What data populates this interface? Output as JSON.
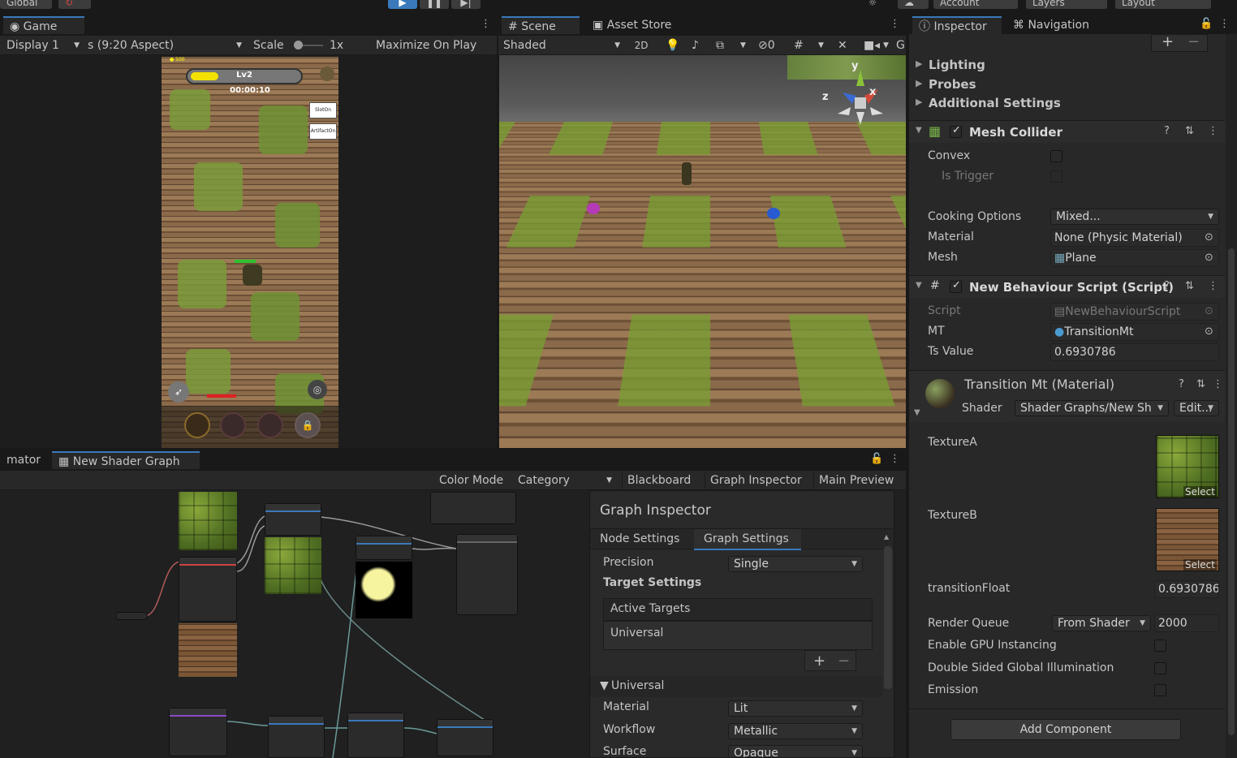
{
  "toolbar": {
    "global_label": "Global",
    "account_label": "Account",
    "layers_label": "Layers",
    "layout_label": "Layout"
  },
  "game": {
    "tab_label": "Game",
    "display": "Display 1",
    "aspect": "s (9:20 Aspect)",
    "scale_label": "Scale",
    "scale_value": "1x",
    "maximize": "Maximize On Play",
    "hud_level": "Lv2",
    "hud_timer": "00:00:10",
    "hud_coins": "500",
    "slot_button": "SlotOn",
    "artifact_button": "ArtifactOn"
  },
  "scene": {
    "tab_label": "Scene",
    "asset_store_label": "Asset Store",
    "shading": "Shaded",
    "mode_2d": "2D",
    "hidden_count": "0",
    "gizmo_y": "y",
    "gizmo_x": "x",
    "gizmo_z": "z"
  },
  "shader_graph": {
    "animator_tab": "mator",
    "tab_label": "New Shader Graph",
    "color_mode_label": "Color Mode",
    "color_mode_value": "Category",
    "blackboard": "Blackboard",
    "graph_inspector": "Graph Inspector",
    "main_preview": "Main Preview"
  },
  "graph_inspector": {
    "title": "Graph Inspector",
    "tab_node": "Node Settings",
    "tab_graph": "Graph Settings",
    "precision_label": "Precision",
    "precision_value": "Single",
    "target_settings": "Target Settings",
    "active_targets": "Active Targets",
    "target_universal": "Universal",
    "section_universal": "Universal",
    "material_label": "Material",
    "material_value": "Lit",
    "workflow_label": "Workflow",
    "workflow_value": "Metallic",
    "surface_label": "Surface",
    "surface_value": "Opaque"
  },
  "inspector": {
    "tab_label": "Inspector",
    "navigation_label": "Navigation",
    "lighting": "Lighting",
    "probes": "Probes",
    "additional_settings": "Additional Settings",
    "mesh_collider": {
      "title": "Mesh Collider",
      "convex_label": "Convex",
      "is_trigger_label": "Is Trigger",
      "cooking_label": "Cooking Options",
      "cooking_value": "Mixed...",
      "material_label": "Material",
      "material_value": "None (Physic Material)",
      "mesh_label": "Mesh",
      "mesh_value": "Plane"
    },
    "script_component": {
      "title": "New Behaviour Script (Script)",
      "script_label": "Script",
      "script_value": "NewBehaviourScript",
      "mt_label": "MT",
      "mt_value": "TransitionMt",
      "ts_label": "Ts Value",
      "ts_value": "0.6930786"
    },
    "material": {
      "title": "Transition Mt (Material)",
      "shader_label": "Shader",
      "shader_value": "Shader Graphs/New Sh",
      "edit_button": "Edit...",
      "texture_a": "TextureA",
      "texture_b": "TextureB",
      "select_label": "Select",
      "transition_label": "transitionFloat",
      "transition_value": "0.6930786",
      "render_queue_label": "Render Queue",
      "render_queue_mode": "From Shader",
      "render_queue_value": "2000",
      "gpu_instancing": "Enable GPU Instancing",
      "double_sided": "Double Sided Global Illumination",
      "emission": "Emission"
    },
    "add_component": "Add Component"
  }
}
